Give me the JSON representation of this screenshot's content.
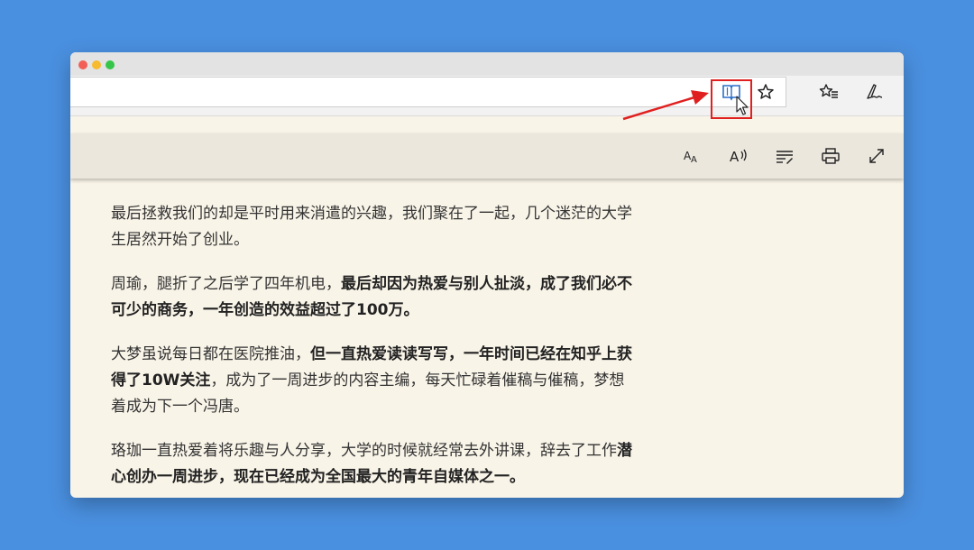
{
  "window": {
    "traffic_lights": [
      "close",
      "minimize",
      "maximize"
    ]
  },
  "toolbar": {
    "address_value": "",
    "icons": [
      "reading-view-icon",
      "favorite-star-icon",
      "favorites-list-icon",
      "pen-icon"
    ],
    "highlight_color": "#e02020"
  },
  "reading_bar": {
    "icons": [
      "text-size-icon",
      "read-aloud-icon",
      "text-options-icon",
      "print-icon",
      "fullscreen-icon"
    ]
  },
  "article": {
    "p1": {
      "text": "最后拯救我们的却是平时用来消遣的兴趣，我们聚在了一起，几个迷茫的大学生居然开始了创业。"
    },
    "p2": {
      "pre": "周瑜，腿折了之后学了四年机电，",
      "bold": "最后却因为热爱与别人扯淡，成了我们必不可少的商务，一年创造的效益超过了100万。"
    },
    "p3": {
      "pre": "大梦虽说每日都在医院推油，",
      "bold": "但一直热爱读读写写，一年时间已经在知乎上获得了10W关注",
      "post": "，成为了一周进步的内容主编，每天忙碌着催稿与催稿，梦想着成为下一个冯唐。"
    },
    "p4": {
      "pre": "珞珈一直热爱着将乐趣与人分享，大学的时候就经常去外讲课，辞去了工作",
      "bold": "潜心创办一周进步，现在已经成为全国最大的青年自媒体之一。"
    }
  },
  "colors": {
    "background": "#4a90e0",
    "page": "#f9f4e8",
    "arrow": "#e02020"
  }
}
